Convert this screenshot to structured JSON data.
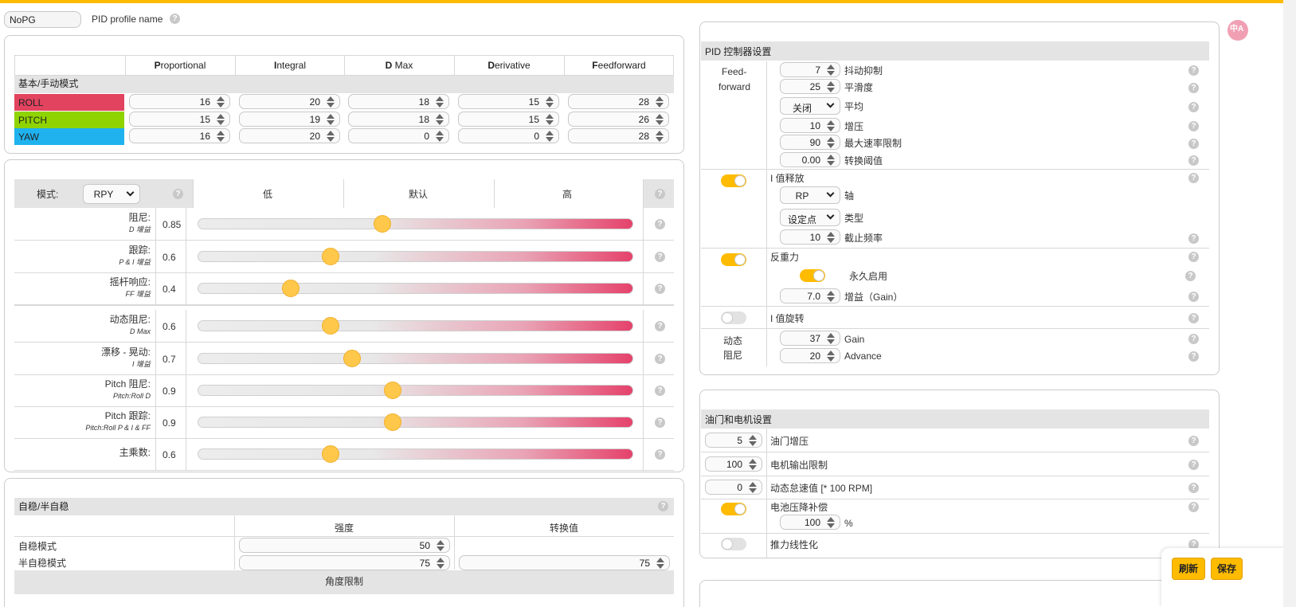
{
  "profile": {
    "name_value": "NoPG",
    "label": "PID profile name"
  },
  "help_glyph": "?",
  "pid_table": {
    "headers": [
      "Proportional",
      "Integral",
      "D Max",
      "Derivative",
      "Feedforward"
    ],
    "header_first_letters": [
      "P",
      "I",
      "D",
      "D",
      "F"
    ],
    "header_rest": [
      "roportional",
      "ntegral",
      " Max",
      "erivative",
      "eedforward"
    ],
    "section_label": "基本/手动模式",
    "rows": [
      {
        "axis": "ROLL",
        "color": "#e2435f",
        "values": [
          "16",
          "20",
          "18",
          "15",
          "28"
        ]
      },
      {
        "axis": "PITCH",
        "color": "#8fd400",
        "values": [
          "15",
          "19",
          "18",
          "15",
          "26"
        ]
      },
      {
        "axis": "YAW",
        "color": "#1fb2ef",
        "values": [
          "16",
          "20",
          "0",
          "0",
          "28"
        ]
      }
    ]
  },
  "sliders": {
    "mode_label": "模式:",
    "mode_value": "RPY",
    "col_low": "低",
    "col_default": "默认",
    "col_high": "高",
    "rows": [
      {
        "label": "阻尼:",
        "sub": "D 增益",
        "value": "0.85",
        "position": 0.425
      },
      {
        "label": "跟踪:",
        "sub": "P & I 增益",
        "value": "0.6",
        "position": 0.306
      },
      {
        "label": "摇杆响应:",
        "sub": "FF 增益",
        "value": "0.4",
        "position": 0.214
      },
      {
        "label": "动态阻尼:",
        "sub": "D Max",
        "value": "0.6",
        "position": 0.306
      },
      {
        "label": "漂移 - 晃动:",
        "sub": "I 增益",
        "value": "0.7",
        "position": 0.355
      },
      {
        "label": "Pitch 阻尼:",
        "sub": "Pitch:Roll D",
        "value": "0.9",
        "position": 0.447
      },
      {
        "label": "Pitch 跟踪:",
        "sub": "Pitch:Roll P & I & FF",
        "value": "0.9",
        "position": 0.447
      },
      {
        "label": "主乘数:",
        "sub": "",
        "value": "0.6",
        "position": 0.306
      }
    ]
  },
  "angle": {
    "title": "自稳/半自稳",
    "col_strength": "强度",
    "col_transition": "转换值",
    "angle_mode_label": "自稳模式",
    "angle_mode_value": "50",
    "horizon_mode_label": "半自稳模式",
    "horizon_mode_value": "75",
    "horizon_transition_value": "75",
    "angle_limit_label": "角度限制"
  },
  "pid_controller": {
    "title": "PID 控制器设置",
    "ff_label_line1": "Feed-",
    "ff_label_line2": "forward",
    "ff_jitter_value": "7",
    "ff_jitter_label": "抖动抑制",
    "ff_smooth_value": "25",
    "ff_smooth_label": "平滑度",
    "ff_average_value": "关闭",
    "ff_average_label": "平均",
    "ff_boost_value": "10",
    "ff_boost_label": "增压",
    "ff_maxrate_value": "90",
    "ff_maxrate_label": "最大速率限制",
    "ff_transition_value": "0.00",
    "ff_transition_label": "转换阈值",
    "iterm_relax_label": "I 值释放",
    "iterm_axes_value": "RP",
    "iterm_axes_label": "轴",
    "iterm_type_value": "设定点",
    "iterm_type_label": "类型",
    "iterm_cutoff_value": "10",
    "iterm_cutoff_label": "截止频率",
    "antigravity_label": "反重力",
    "antigravity_permanent_label": "永久启用",
    "antigravity_gain_value": "7.0",
    "antigravity_gain_label": "增益（Gain）",
    "iterm_rotation_label": "I 值旋转",
    "dyn_damp_line1": "动态",
    "dyn_damp_line2": "阻尼",
    "dyn_gain_value": "37",
    "dyn_gain_label": "Gain",
    "dyn_advance_value": "20",
    "dyn_advance_label": "Advance"
  },
  "throttle": {
    "title": "油门和电机设置",
    "boost_value": "5",
    "boost_label": "油门增压",
    "motor_limit_value": "100",
    "motor_limit_label": "电机输出限制",
    "dyn_idle_value": "0",
    "dyn_idle_label": "动态怠速值 [* 100 RPM]",
    "vbat_sag_label": "电池压降补偿",
    "vbat_sag_value": "100",
    "vbat_sag_unit": "%",
    "thrust_linear_label": "推力线性化"
  },
  "buttons": {
    "refresh": "刷新",
    "save": "保存"
  },
  "widget_badge": "中A",
  "colors": {
    "accent": "#ffbb00",
    "roll": "#e2435f",
    "pitch": "#8fd400",
    "yaw": "#1fb2ef"
  }
}
